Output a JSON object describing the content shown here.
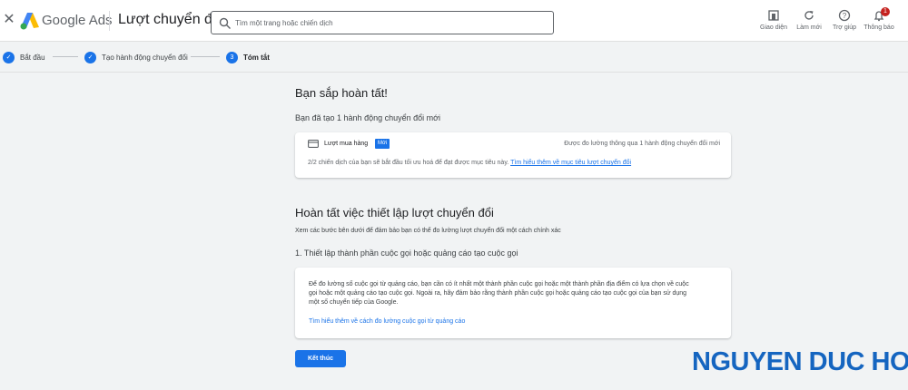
{
  "header": {
    "close_icon": "close-icon",
    "brand": "Google Ads",
    "title": "Lượt chuyển đổi",
    "search_placeholder": "Tìm một trang hoặc chiến dịch",
    "tools": [
      {
        "icon": "appearance-icon",
        "label": "Giao diện"
      },
      {
        "icon": "refresh-icon",
        "label": "Làm mới"
      },
      {
        "icon": "help-icon",
        "label": "Trợ giúp"
      },
      {
        "icon": "bell-icon",
        "label": "Thông báo",
        "badge": "1"
      }
    ]
  },
  "stepper": {
    "steps": [
      {
        "label": "Bắt đầu",
        "state": "done"
      },
      {
        "label": "Tạo hành động chuyển đổi",
        "state": "done"
      },
      {
        "label": "Tóm tắt",
        "state": "current",
        "number": "3"
      }
    ]
  },
  "summary": {
    "title": "Bạn sắp hoàn tất!",
    "subtitle": "Bạn đã tạo 1 hành động chuyển đổi mới",
    "conversion": {
      "name": "Lượt mua hàng",
      "badge": "Mới",
      "measure_text": "Được đo lường thông qua 1 hành động chuyển đổi mới",
      "campaign_text": "2/2 chiến dịch của bạn sẽ bắt đầu tối ưu hoá để đạt được mục tiêu này.",
      "learn_more": "Tìm hiểu thêm về mục tiêu lượt chuyển đổi"
    }
  },
  "setup": {
    "title": "Hoàn tất việc thiết lập lượt chuyển đổi",
    "description": "Xem các bước bên dưới để đảm bảo bạn có thể đo lường lượt chuyển đổi một cách chính xác",
    "step1_title": "1. Thiết lập thành phần cuộc gọi hoặc quảng cáo tạo cuộc gọi",
    "step1_body": "Để đo lường số cuộc gọi từ quảng cáo, bạn cần có ít nhất một thành phần cuộc gọi hoặc một thành phần địa điểm có lựa chọn về cuộc gọi hoặc một quảng cáo tạo cuộc gọi. Ngoài ra, hãy đảm bảo rằng thành phần cuộc gọi hoặc quảng cáo tạo cuộc gọi của bạn sử dụng một số chuyển tiếp của Google.",
    "step1_link": "Tìm hiểu thêm về cách đo lường cuộc gọi từ quảng cáo"
  },
  "footer": {
    "finish_label": "Kết thúc"
  },
  "watermark": {
    "text": "NGUYEN DUC HOA"
  },
  "colors": {
    "accent": "#1a73e8",
    "badge_red": "#c5221f",
    "background": "#f1f3f4",
    "watermark": "#1565c0"
  }
}
